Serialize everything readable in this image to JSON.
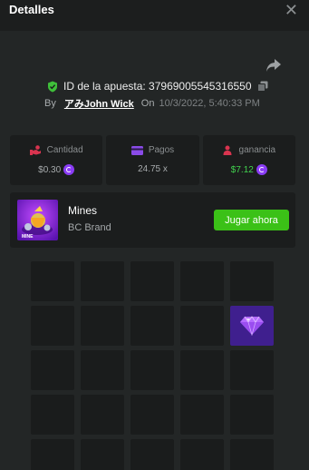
{
  "header": {
    "title": "Detalles",
    "close_icon": "close-icon"
  },
  "bet": {
    "id_label": "ID de la apuesta: 37969005545316550",
    "by_label": "By",
    "username": "アみJohn Wick",
    "on_label": "On",
    "date": "10/3/2022, 5:40:33 PM"
  },
  "stats": [
    {
      "label": "Cantidad",
      "value": "$0.30",
      "icon": "money-hand-icon",
      "coin": true
    },
    {
      "label": "Pagos",
      "value": "24.75 x",
      "icon": "card-icon",
      "coin": false
    },
    {
      "label": "ganancia",
      "value": "$7.12",
      "icon": "person-coin-icon",
      "coin": true
    }
  ],
  "game": {
    "name": "Mines",
    "brand": "BC Brand",
    "play_label": "Jugar ahora",
    "thumb_label": "MINE"
  },
  "board": {
    "visible_rows": 5,
    "columns": 5,
    "gem_row": 1,
    "gem_col": 4
  },
  "colors": {
    "background": "#232626",
    "panel": "#1b1d1d",
    "accent_green": "#3bc117",
    "win_green": "#41d24e",
    "coin_purple": "#8a3cf5",
    "gem_tile": "#3f1f8e"
  }
}
